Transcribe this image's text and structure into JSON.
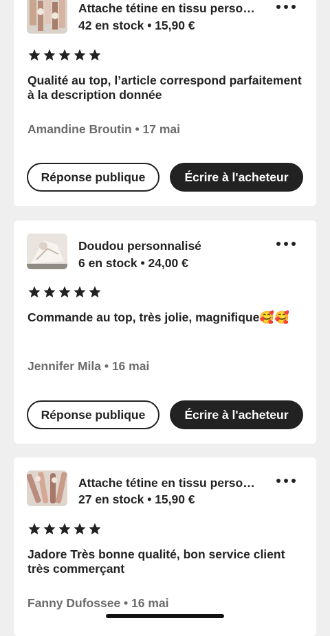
{
  "reviews": [
    {
      "product_title": "Attache tétine en tissu personnalisée",
      "stock_price": "42 en stock • 15,90 €",
      "rating": 5,
      "text": "Qualité au top, l’article correspond parfaitement à la description donnée",
      "author_date": "Amandine Broutin • 17 mai",
      "public_reply_label": "Réponse publique",
      "write_buyer_label": "Écrire à l'acheteur"
    },
    {
      "product_title": "Doudou personnalisé",
      "stock_price": "6 en stock • 24,00 €",
      "rating": 5,
      "text": "Commande au top, très jolie, magnifique🥰🥰",
      "author_date": "Jennifer Mila • 16 mai",
      "public_reply_label": "Réponse publique",
      "write_buyer_label": "Écrire à l'acheteur"
    },
    {
      "product_title": "Attache tétine en tissu personnalisée",
      "stock_price": "27 en stock • 15,90 €",
      "rating": 5,
      "text": "Jadore Très bonne qualité, bon service client très commerçant",
      "author_date": "Fanny Dufossee • 16 mai"
    }
  ],
  "icons": {
    "more": "more-horizontal-icon",
    "star": "star-icon"
  },
  "colors": {
    "text": "#222222",
    "muted": "#6b6b6b",
    "button_dark": "#222222",
    "background": "#efefef"
  }
}
